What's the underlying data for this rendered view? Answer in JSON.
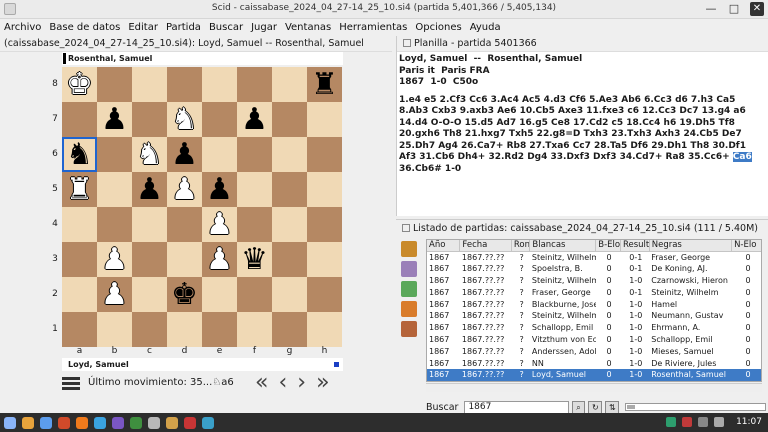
{
  "window": {
    "title": "Scid - caissabase_2024_04_27-14_25_10.si4 (partida 5,401,366 / 5,405,134)"
  },
  "menu": [
    {
      "label": "Archivo"
    },
    {
      "label": "Base de datos"
    },
    {
      "label": "Editar"
    },
    {
      "label": "Partida"
    },
    {
      "label": "Buscar"
    },
    {
      "label": "Jugar"
    },
    {
      "label": "Ventanas"
    },
    {
      "label": "Herramientas"
    },
    {
      "label": "Opciones"
    },
    {
      "label": "Ayuda"
    }
  ],
  "board_panel": {
    "header": "(caissabase_2024_04_27-14_25_10.si4): Loyd, Samuel -- Rosenthal, Samuel",
    "black_player": "Rosenthal, Samuel",
    "white_player": "Loyd, Samuel",
    "ranks": [
      "8",
      "7",
      "6",
      "5",
      "4",
      "3",
      "2",
      "1"
    ],
    "files": [
      "a",
      "b",
      "c",
      "d",
      "e",
      "f",
      "g",
      "h"
    ],
    "last_move": "Último movimiento: 35...♘a6",
    "position": [
      [
        "wK",
        "",
        "",
        "",
        "",
        "",
        "",
        "bR"
      ],
      [
        "",
        "bP",
        "",
        "wN",
        "",
        "bP",
        "",
        ""
      ],
      [
        "bN",
        "",
        "wN",
        "bP",
        "",
        "",
        "",
        ""
      ],
      [
        "wR",
        "",
        "bP",
        "wP",
        "bP",
        "",
        "",
        ""
      ],
      [
        "",
        "",
        "",
        "",
        "wP",
        "",
        "",
        ""
      ],
      [
        "",
        "wP",
        "",
        "",
        "wP",
        "bQ",
        "",
        ""
      ],
      [
        "",
        "wP",
        "",
        "bK",
        "",
        "",
        "",
        ""
      ],
      [
        "",
        "",
        "",
        "",
        "",
        "",
        "",
        ""
      ]
    ],
    "highlight": [
      "a6"
    ]
  },
  "pgn_panel": {
    "header": "Planilla - partida 5401366",
    "line1": "Loyd, Samuel  --  Rosenthal, Samuel",
    "line2": "Paris it  Paris FRA",
    "line3": "1867  1-0  C50o",
    "moves_before": "1.e4 e5 2.Cf3 Cc6 3.Ac4 Ac5 4.d3 Cf6 5.Ae3 Ab6 6.Cc3 d6 7.h3 Ca5 8.Ab3 Cxb3 9.axb3 Ae6 10.Cb5 Axe3 11.fxe3 c6 12.Cc3 Dc7 13.g4 a6 14.d4 O-O-O 15.d5 Ad7 16.g5 Ce8 17.Cd2 c5 18.Cc4 h6 19.Dh5 Tf8 20.gxh6 Th8 21.hxg7 Txh5 22.g8=D Txh3 23.Txh3 Axh3 24.Cb5 De7 25.Dh7 Ag4 26.Ca7+ Rb8 27.Txa6 Cc7 28.Ta5 Df6 29.Dh1 Th8 30.Df1 Af3 31.Cb6 Dh4+ 32.Rd2 Dg4 33.Dxf3 Dxf3 34.Cd7+ Ra8 35.Cc6+ ",
    "move_current": "Ca6",
    "moves_after": " 36.Cb6# 1-0"
  },
  "list_panel": {
    "header": "Listado de partidas: caissabase_2024_04_27-14_25_10.si4 (111 / 5.40M)",
    "columns": [
      "Año",
      "Fecha",
      "Ron",
      "Blancas",
      "B-Elo",
      "Resulta",
      "Negras",
      "N-Elo"
    ],
    "rows": [
      [
        "1867",
        "1867.??.??",
        "?",
        "Steinitz, Wilhelm",
        "0",
        "0-1",
        "Fraser, George",
        "0"
      ],
      [
        "1867",
        "1867.??.??",
        "?",
        "Spoelstra, B.",
        "0",
        "0-1",
        "De Koning, AJ.",
        "0"
      ],
      [
        "1867",
        "1867.??.??",
        "?",
        "Steinitz, Wilhelm",
        "0",
        "1-0",
        "Czarnowski, Hieron",
        "0"
      ],
      [
        "1867",
        "1867.??.??",
        "?",
        "Fraser, George",
        "0",
        "0-1",
        "Steinitz, Wilhelm",
        "0"
      ],
      [
        "1867",
        "1867.??.??",
        "?",
        "Blackburne, Joseph",
        "0",
        "1-0",
        "Hamel",
        "0"
      ],
      [
        "1867",
        "1867.??.??",
        "?",
        "Steinitz, Wilhelm",
        "0",
        "1-0",
        "Neumann, Gustav",
        "0"
      ],
      [
        "1867",
        "1867.??.??",
        "?",
        "Schallopp, Emil",
        "0",
        "1-0",
        "Ehrmann, A.",
        "0"
      ],
      [
        "1867",
        "1867.??.??",
        "?",
        "Vitzthum von Ecks",
        "0",
        "1-0",
        "Schallopp, Emil",
        "0"
      ],
      [
        "1867",
        "1867.??.??",
        "?",
        "Anderssen, Adolf",
        "0",
        "1-0",
        "Mieses, Samuel",
        "0"
      ],
      [
        "1867",
        "1867.??.??",
        "?",
        "NN",
        "0",
        "1-0",
        "De Riviere, Jules",
        "0"
      ],
      [
        "1867",
        "1867.??.??",
        "?",
        "Loyd, Samuel",
        "0",
        "1-0",
        "Rosenthal, Samuel",
        "0"
      ]
    ],
    "selected_index": 10,
    "search_label": "Buscar",
    "search_value": "1867"
  },
  "taskbar": {
    "clock": "11:07"
  },
  "colors": {
    "light_square": "#f0d9b5",
    "dark_square": "#b58863",
    "selection": "#3e7bc6"
  }
}
